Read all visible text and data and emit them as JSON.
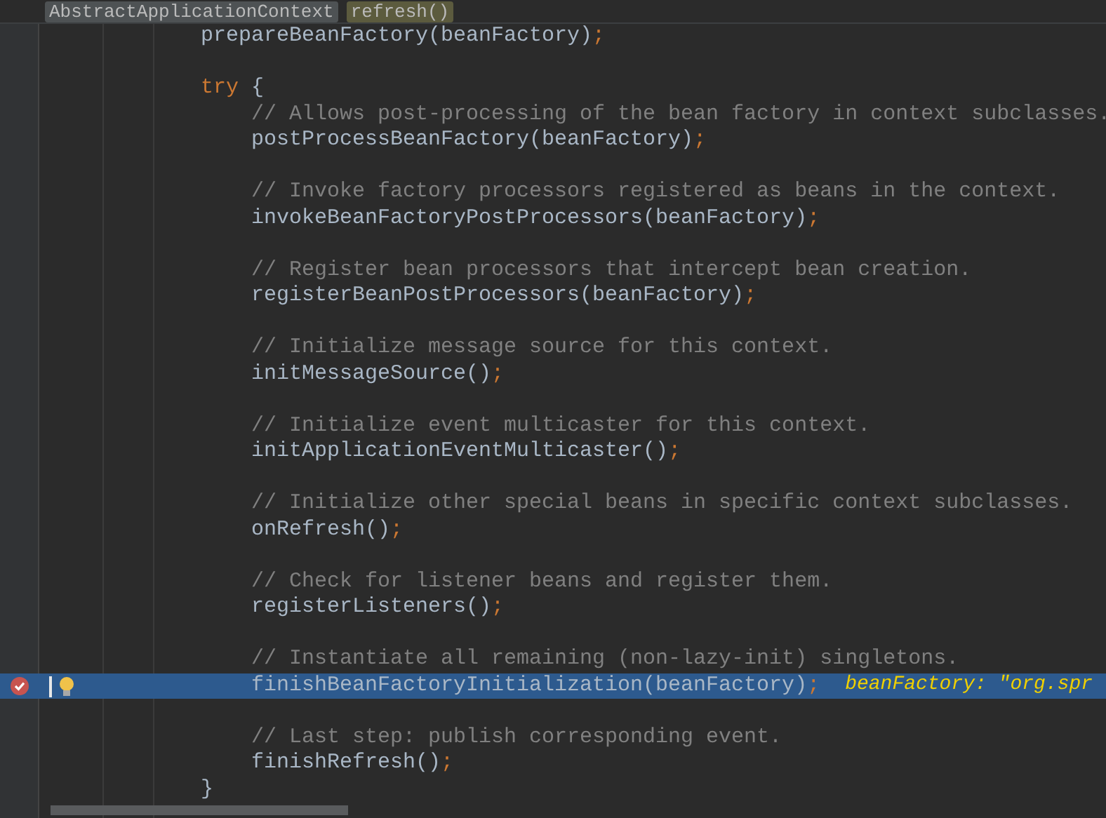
{
  "breadcrumbs": [
    {
      "label": "AbstractApplicationContext",
      "selected": false
    },
    {
      "label": "refresh()",
      "selected": true
    }
  ],
  "blocks": [
    {
      "kind": "statement",
      "parts": [
        {
          "kind": "plain",
          "text": "prepareBeanFactory(beanFactory)"
        },
        {
          "kind": "punct",
          "text": ";"
        }
      ]
    },
    {
      "kind": "try",
      "parts": [
        {
          "kind": "keyword",
          "text": "try"
        },
        {
          "kind": "plain",
          "text": " {"
        }
      ],
      "close": "}",
      "children": [
        {
          "comment": "// Allows post-processing of the bean factory in context subclasses.",
          "code": [
            {
              "kind": "plain",
              "text": "postProcessBeanFactory(beanFactory)"
            },
            {
              "kind": "punct",
              "text": ";"
            }
          ],
          "breakpoint": false,
          "current": false
        },
        {
          "comment": "// Invoke factory processors registered as beans in the context.",
          "code": [
            {
              "kind": "plain",
              "text": "invokeBeanFactoryPostProcessors(beanFactory)"
            },
            {
              "kind": "punct",
              "text": ";"
            }
          ],
          "breakpoint": false,
          "current": false
        },
        {
          "comment": "// Register bean processors that intercept bean creation.",
          "code": [
            {
              "kind": "plain",
              "text": "registerBeanPostProcessors(beanFactory)"
            },
            {
              "kind": "punct",
              "text": ";"
            }
          ],
          "breakpoint": false,
          "current": false
        },
        {
          "comment": "// Initialize message source for this context.",
          "code": [
            {
              "kind": "plain",
              "text": "initMessageSource()"
            },
            {
              "kind": "punct",
              "text": ";"
            }
          ],
          "breakpoint": false,
          "current": false
        },
        {
          "comment": "// Initialize event multicaster for this context.",
          "code": [
            {
              "kind": "plain",
              "text": "initApplicationEventMulticaster()"
            },
            {
              "kind": "punct",
              "text": ";"
            }
          ],
          "breakpoint": false,
          "current": false
        },
        {
          "comment": "// Initialize other special beans in specific context subclasses.",
          "code": [
            {
              "kind": "plain",
              "text": "onRefresh()"
            },
            {
              "kind": "punct",
              "text": ";"
            }
          ],
          "breakpoint": false,
          "current": false
        },
        {
          "comment": "// Check for listener beans and register them.",
          "code": [
            {
              "kind": "plain",
              "text": "registerListeners()"
            },
            {
              "kind": "punct",
              "text": ";"
            }
          ],
          "breakpoint": false,
          "current": false
        },
        {
          "comment": "// Instantiate all remaining (non-lazy-init) singletons.",
          "code": [
            {
              "kind": "plain",
              "text": "finishBeanFactoryInitialization(beanFactory)"
            },
            {
              "kind": "punct",
              "text": ";"
            }
          ],
          "breakpoint": true,
          "current": true,
          "inline_value": "beanFactory: \"org.spr"
        },
        {
          "comment": "// Last step: publish corresponding event.",
          "code": [
            {
              "kind": "plain",
              "text": "finishRefresh()"
            },
            {
              "kind": "punct",
              "text": ";"
            }
          ],
          "breakpoint": false,
          "current": false
        }
      ]
    }
  ]
}
